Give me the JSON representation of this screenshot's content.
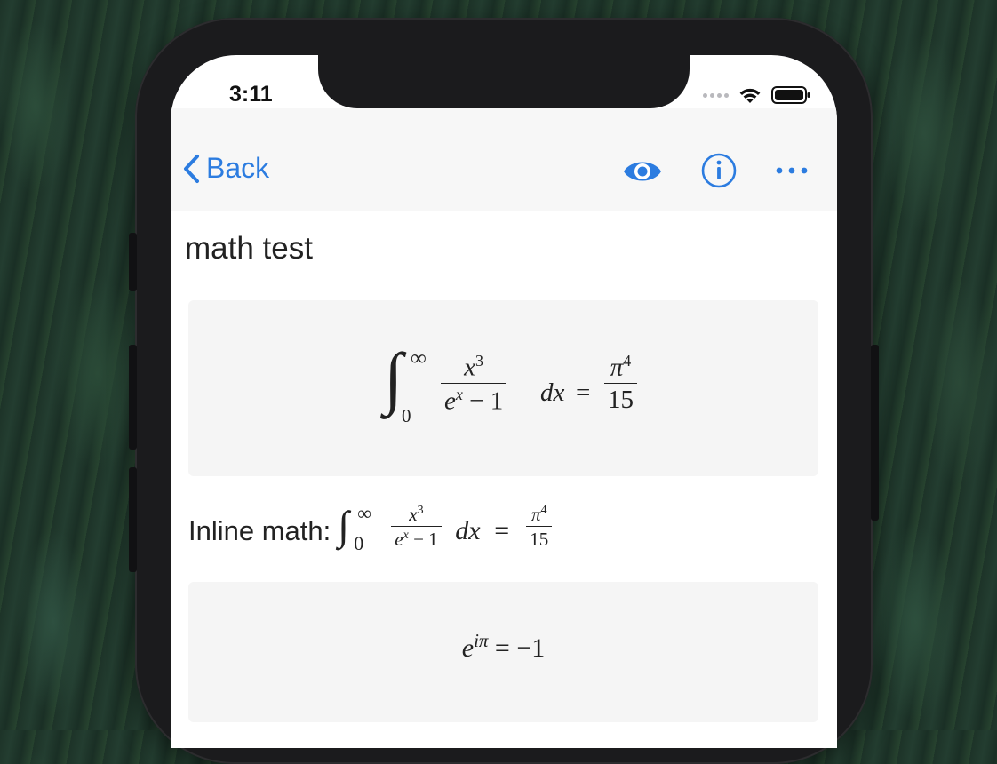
{
  "status_bar": {
    "time": "3:11"
  },
  "nav": {
    "back_label": "Back"
  },
  "note": {
    "title": "math test",
    "inline_label": "Inline math:"
  },
  "math": {
    "integral_upper": "∞",
    "integral_lower": "0",
    "num_base": "x",
    "num_exp": "3",
    "den_base": "e",
    "den_exp": "x",
    "den_tail": " − 1",
    "differential": "dx",
    "equals": "=",
    "rhs_base": "π",
    "rhs_exp": "4",
    "rhs_den": "15",
    "euler_base": "e",
    "euler_exp": "iπ",
    "euler_rhs": "= −1"
  },
  "colors": {
    "accent": "#2c7ce0",
    "block_bg": "#f5f5f5",
    "navbar_bg": "#f7f7f7"
  },
  "icons": [
    "chevron-left-icon",
    "eye-icon",
    "info-icon",
    "more-icon",
    "wifi-icon",
    "battery-icon"
  ]
}
